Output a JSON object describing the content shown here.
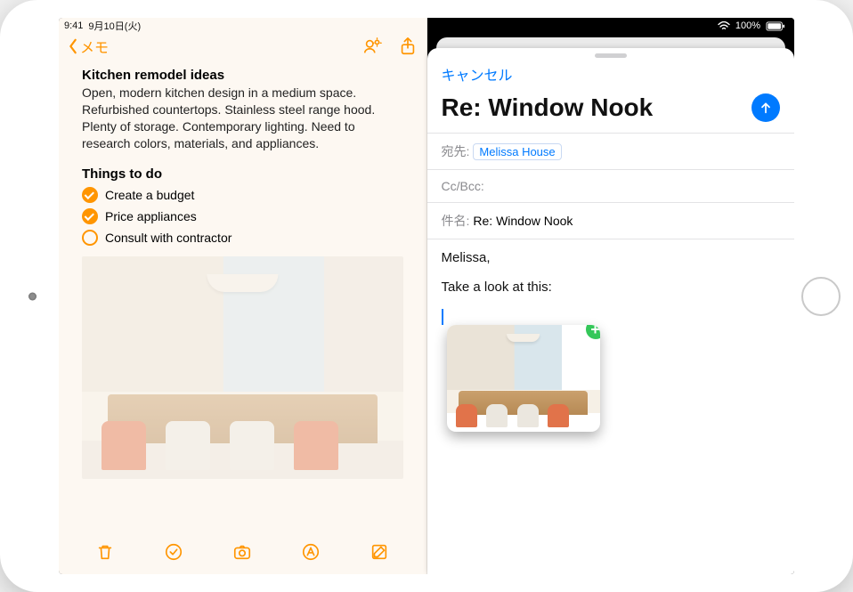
{
  "status": {
    "time": "9:41",
    "date": "9月10日(火)",
    "battery": "100%"
  },
  "notes": {
    "back_label": "メモ",
    "title": "Kitchen remodel ideas",
    "paragraph": "Open, modern kitchen design in a medium space. Refurbished countertops. Stainless steel range hood. Plenty of storage. Contemporary lighting. Need to research colors, materials, and appliances.",
    "section": "Things to do",
    "todos": [
      {
        "label": "Create a budget",
        "done": true
      },
      {
        "label": "Price appliances",
        "done": true
      },
      {
        "label": "Consult with contractor",
        "done": false
      }
    ]
  },
  "mail": {
    "cancel": "キャンセル",
    "subject_display": "Re:  Window Nook",
    "to_label": "宛先:",
    "to_value": "Melissa House",
    "ccbcc_label": "Cc/Bcc:",
    "subject_label": "件名:",
    "subject_value": "Re:  Window Nook",
    "body_line1": "Melissa,",
    "body_line2": "Take a look at this:"
  }
}
